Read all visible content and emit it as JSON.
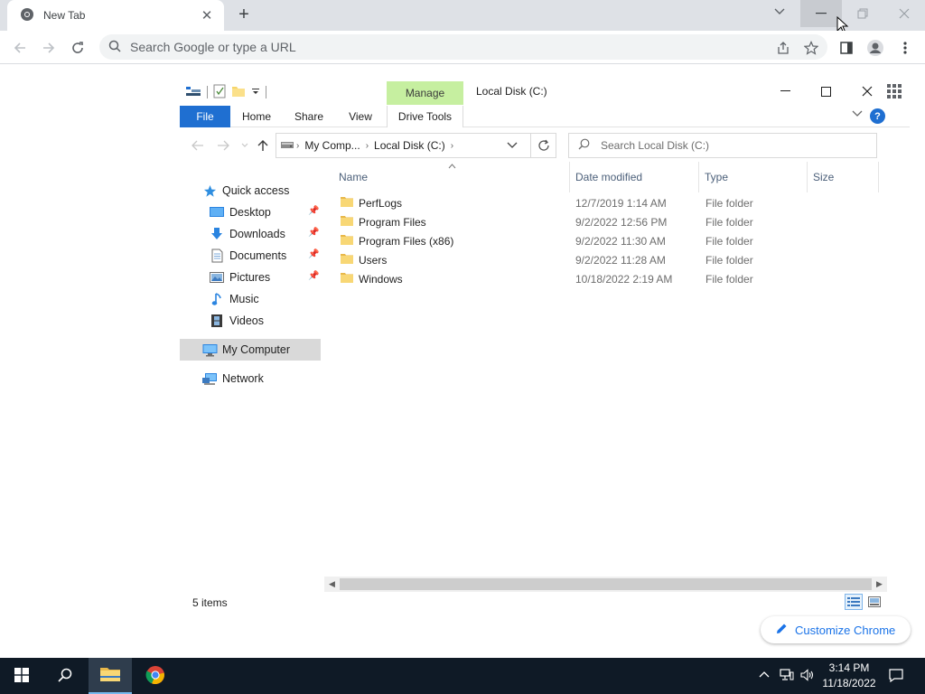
{
  "browser": {
    "tab_title": "New Tab",
    "omnibox_placeholder": "Search Google or type a URL",
    "customize_label": "Customize Chrome"
  },
  "explorer": {
    "window_title": "Local Disk (C:)",
    "ribbon": {
      "manage_label": "Manage",
      "tabs": [
        "File",
        "Home",
        "Share",
        "View",
        "Drive Tools"
      ]
    },
    "address": {
      "crumbs": [
        "My Comp...",
        "Local Disk (C:)"
      ]
    },
    "search_placeholder": "Search Local Disk (C:)",
    "nav": {
      "quick_access": "Quick access",
      "items": [
        "Desktop",
        "Downloads",
        "Documents",
        "Pictures",
        "Music",
        "Videos"
      ],
      "my_computer": "My Computer",
      "network": "Network"
    },
    "columns": [
      "Name",
      "Date modified",
      "Type",
      "Size"
    ],
    "files": [
      {
        "name": "PerfLogs",
        "date": "12/7/2019 1:14 AM",
        "type": "File folder"
      },
      {
        "name": "Program Files",
        "date": "9/2/2022 12:56 PM",
        "type": "File folder"
      },
      {
        "name": "Program Files (x86)",
        "date": "9/2/2022 11:30 AM",
        "type": "File folder"
      },
      {
        "name": "Users",
        "date": "9/2/2022 11:28 AM",
        "type": "File folder"
      },
      {
        "name": "Windows",
        "date": "10/18/2022 2:19 AM",
        "type": "File folder"
      }
    ],
    "status": "5 items"
  },
  "taskbar": {
    "time": "3:14 PM",
    "date": "11/18/2022"
  },
  "colors": {
    "accent_blue": "#1f6fd1",
    "manage_green": "#c6efa0",
    "chrome_link": "#1a73e8",
    "taskbar_bg": "#0f1a26"
  }
}
